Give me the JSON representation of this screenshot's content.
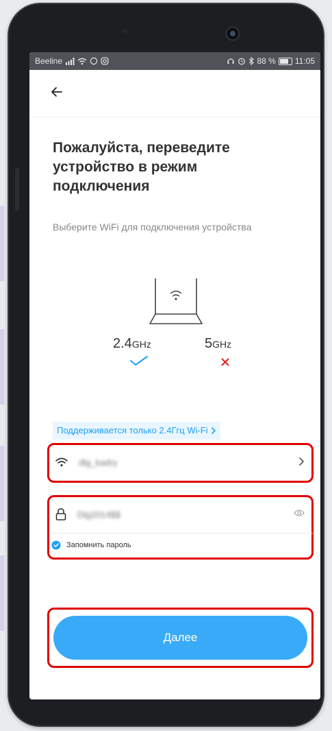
{
  "statusbar": {
    "carrier": "Beeline",
    "battery": "88 %",
    "time": "11:05"
  },
  "header": {
    "title": "Пожалуйста, переведите устройство в режим подключения",
    "subtitle": "Выберите WiFi для подключения устройства"
  },
  "frequencies": {
    "band_24": {
      "value": "2.4",
      "unit": "GHz"
    },
    "band_5": {
      "value": "5",
      "unit": "GHz"
    }
  },
  "notice": {
    "label": "Поддерживается только 2.4Ггц Wi-Fi"
  },
  "wifi": {
    "ssid": "dlg_kadry",
    "password": "Dlg2014$$",
    "remember_label": "Запомнить пароль"
  },
  "actions": {
    "next_label": "Далее"
  },
  "colors": {
    "accent": "#39aaf7",
    "link": "#1da1f2",
    "highlight": "#e00000",
    "check": "#1da1f2",
    "cross": "#e02020"
  }
}
